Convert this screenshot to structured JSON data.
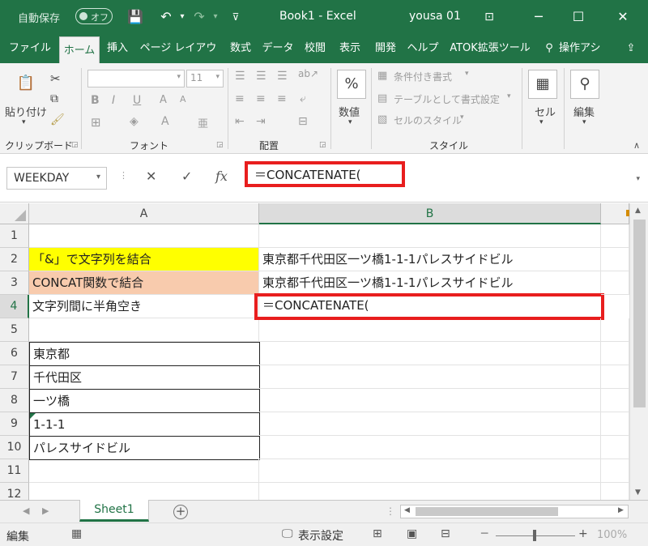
{
  "titlebar": {
    "autosave": "自動保存",
    "toggle_state": "オフ",
    "doc_title": "Book1  -  Excel",
    "user": "yousa 01",
    "bg_color": "#217346"
  },
  "tabs": [
    "ファイル",
    "ホーム",
    "挿入",
    "ページ レイアウト",
    "数式",
    "データ",
    "校閲",
    "表示",
    "開発",
    "ヘルプ",
    "ATOK拡張ツール",
    "操作アシ"
  ],
  "ribbon": {
    "paste": "貼り付け",
    "font_name": "",
    "font_size": "11",
    "number_label": "数値",
    "cond_format": "条件付き書式",
    "table_format": "テーブルとして書式設定",
    "cell_styles": "セルのスタイル",
    "cells_label": "セル",
    "edit_label": "編集",
    "groups": [
      "クリップボード",
      "フォント",
      "配置",
      "スタイル"
    ]
  },
  "formula_bar": {
    "namebox": "WEEKDAY",
    "cancel": "✕",
    "enter": "✓",
    "fx": "fx",
    "formula": "＝CONCATENATE(",
    "highlight_color": "#e81e1e"
  },
  "grid": {
    "columns": [
      "A",
      "B"
    ],
    "rows": [
      "1",
      "2",
      "3",
      "4",
      "5",
      "6",
      "7",
      "8",
      "9",
      "10",
      "11",
      "12"
    ],
    "cells": {
      "A2": "「&」で文字列を結合",
      "B2": "東京都千代田区一ツ橋1-1-1パレスサイドビル",
      "A3": "CONCAT関数で結合",
      "B3": "東京都千代田区一ツ橋1-1-1パレスサイドビル",
      "A4": "文字列間に半角空き",
      "B4": "＝CONCATENATE(",
      "A6": "東京都",
      "A7": "千代田区",
      "A8": "一ツ橋",
      "A9": "1-1-1",
      "A10": "パレスサイドビル"
    },
    "active_cell": "B4",
    "fill_yellow": "#ffff00",
    "fill_orange": "#f8cbad"
  },
  "sheets": [
    "Sheet1"
  ],
  "status": {
    "mode": "編集",
    "display_settings": "表示設定",
    "zoom": "100%"
  }
}
